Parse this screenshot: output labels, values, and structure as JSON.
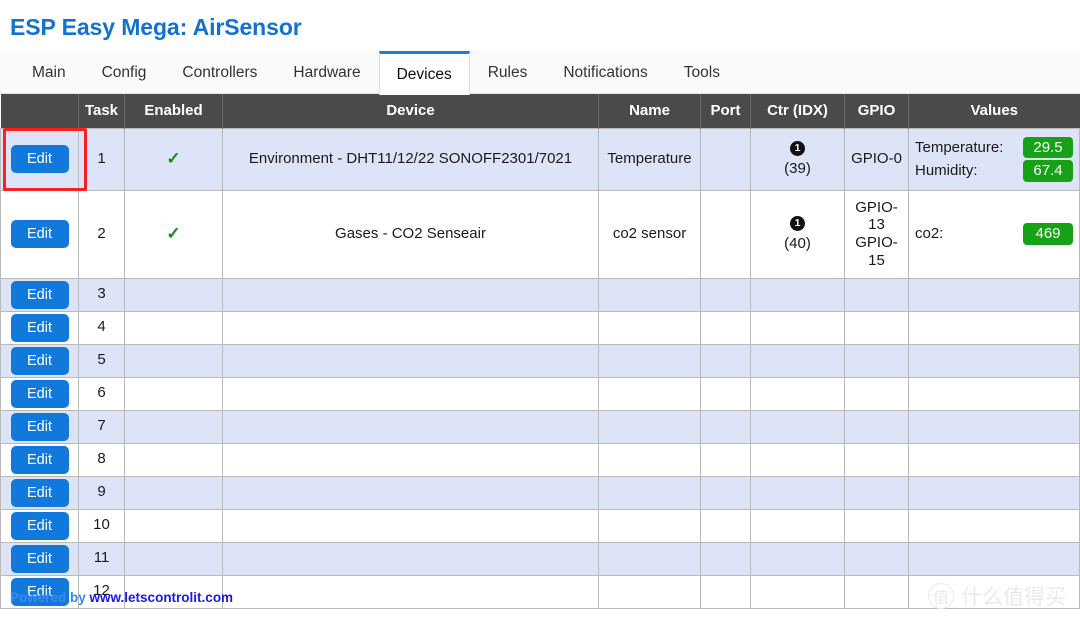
{
  "header": {
    "title": "ESP Easy Mega: AirSensor"
  },
  "nav": {
    "tabs": [
      {
        "label": "Main",
        "active": false
      },
      {
        "label": "Config",
        "active": false
      },
      {
        "label": "Controllers",
        "active": false
      },
      {
        "label": "Hardware",
        "active": false
      },
      {
        "label": "Devices",
        "active": true
      },
      {
        "label": "Rules",
        "active": false
      },
      {
        "label": "Notifications",
        "active": false
      },
      {
        "label": "Tools",
        "active": false
      }
    ]
  },
  "table": {
    "columns": [
      "",
      "Task",
      "Enabled",
      "Device",
      "Name",
      "Port",
      "Ctr (IDX)",
      "GPIO",
      "Values"
    ],
    "edit_label": "Edit",
    "enabled_check": "✓",
    "ctr_badge": "1",
    "rows": [
      {
        "task": "1",
        "enabled": true,
        "device": "Environment - DHT11/12/22 SONOFF2301/7021",
        "name": "Temperature",
        "port": "",
        "ctr_idx": "(39)",
        "gpio": [
          "GPIO-0"
        ],
        "values": [
          {
            "label": "Temperature:",
            "value": "29.5"
          },
          {
            "label": "Humidity:",
            "value": "67.4"
          }
        ],
        "highlighted": true
      },
      {
        "task": "2",
        "enabled": true,
        "device": "Gases - CO2 Senseair",
        "name": "co2 sensor",
        "port": "",
        "ctr_idx": "(40)",
        "gpio": [
          "GPIO-13",
          "GPIO-15"
        ],
        "values": [
          {
            "label": "co2:",
            "value": "469"
          }
        ],
        "highlighted": false
      },
      {
        "task": "3",
        "enabled": false,
        "device": "",
        "name": "",
        "port": "",
        "ctr_idx": "",
        "gpio": [],
        "values": [],
        "highlighted": false
      },
      {
        "task": "4",
        "enabled": false,
        "device": "",
        "name": "",
        "port": "",
        "ctr_idx": "",
        "gpio": [],
        "values": [],
        "highlighted": false
      },
      {
        "task": "5",
        "enabled": false,
        "device": "",
        "name": "",
        "port": "",
        "ctr_idx": "",
        "gpio": [],
        "values": [],
        "highlighted": false
      },
      {
        "task": "6",
        "enabled": false,
        "device": "",
        "name": "",
        "port": "",
        "ctr_idx": "",
        "gpio": [],
        "values": [],
        "highlighted": false
      },
      {
        "task": "7",
        "enabled": false,
        "device": "",
        "name": "",
        "port": "",
        "ctr_idx": "",
        "gpio": [],
        "values": [],
        "highlighted": false
      },
      {
        "task": "8",
        "enabled": false,
        "device": "",
        "name": "",
        "port": "",
        "ctr_idx": "",
        "gpio": [],
        "values": [],
        "highlighted": false
      },
      {
        "task": "9",
        "enabled": false,
        "device": "",
        "name": "",
        "port": "",
        "ctr_idx": "",
        "gpio": [],
        "values": [],
        "highlighted": false
      },
      {
        "task": "10",
        "enabled": false,
        "device": "",
        "name": "",
        "port": "",
        "ctr_idx": "",
        "gpio": [],
        "values": [],
        "highlighted": false
      },
      {
        "task": "11",
        "enabled": false,
        "device": "",
        "name": "",
        "port": "",
        "ctr_idx": "",
        "gpio": [],
        "values": [],
        "highlighted": false
      },
      {
        "task": "12",
        "enabled": false,
        "device": "",
        "name": "",
        "port": "",
        "ctr_idx": "",
        "gpio": [],
        "values": [],
        "highlighted": false
      }
    ]
  },
  "footer": {
    "powered_by": "Powered by",
    "link": "www.letscontrolit.com"
  },
  "watermark": {
    "mark": "值",
    "text": "什么值得买"
  },
  "colors": {
    "accent_blue": "#1272d0",
    "button_blue": "#1279dc",
    "badge_green": "#17a117",
    "highlight_red": "#fa2020",
    "header_gray": "#4a4a4a",
    "row_odd": "#dee4f7"
  }
}
